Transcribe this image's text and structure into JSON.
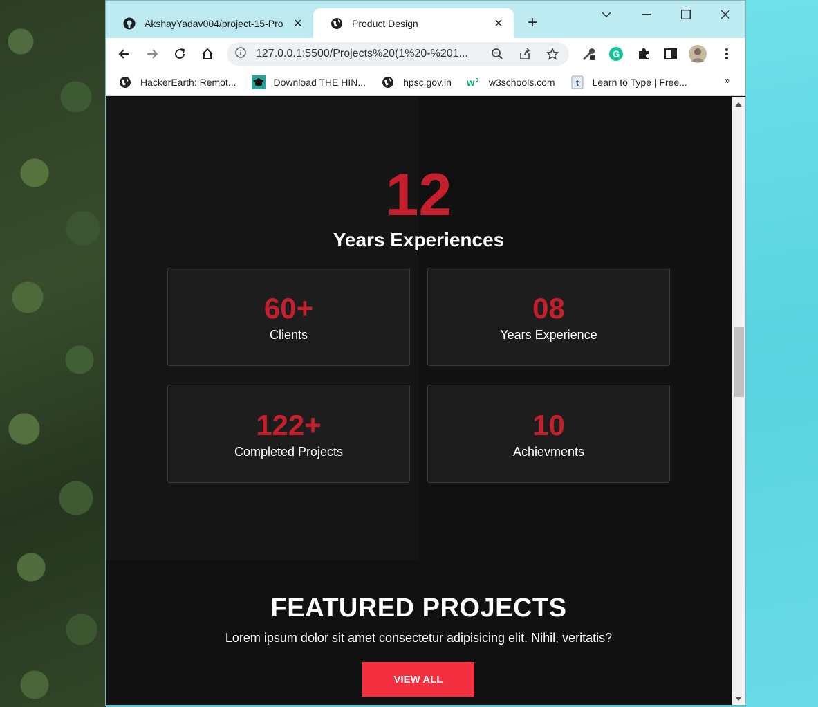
{
  "tabs": [
    {
      "title": "AkshayYadav004/project-15-Pro",
      "icon": "github-icon"
    },
    {
      "title": "Product Design",
      "icon": "globe-icon"
    }
  ],
  "toolbar": {
    "url": "127.0.0.1:5500/Projects%20(1%20-%201..."
  },
  "bookmarks": [
    {
      "label": "HackerEarth: Remot...",
      "icon": "globe-icon"
    },
    {
      "label": "Download THE HIN...",
      "icon": "graduation-cap-icon"
    },
    {
      "label": "hpsc.gov.in",
      "icon": "globe-icon"
    },
    {
      "label": "w3schools.com",
      "icon": "w3schools-icon"
    },
    {
      "label": "Learn to Type | Free...",
      "icon": "typing-t-icon"
    }
  ],
  "bookmarks_more": "»",
  "page": {
    "experience_number": "12",
    "experience_label": "Years Experiences",
    "stats": [
      {
        "value": "60+",
        "label": "Clients"
      },
      {
        "value": "08",
        "label": "Years Experience"
      },
      {
        "value": "122+",
        "label": "Completed Projects"
      },
      {
        "value": "10",
        "label": "Achievments"
      }
    ],
    "featured_title": "FEATURED PROJECTS",
    "featured_subtitle": "Lorem ipsum dolor sit amet consectetur adipisicing elit. Nihil, veritatis?",
    "view_all_label": "VIEW ALL"
  },
  "colors": {
    "accent_red": "#c41f2c",
    "button_red": "#f42f40",
    "page_background": "#111111",
    "card_background": "#1d1d1d",
    "tabbar_background": "#bde9f1"
  }
}
